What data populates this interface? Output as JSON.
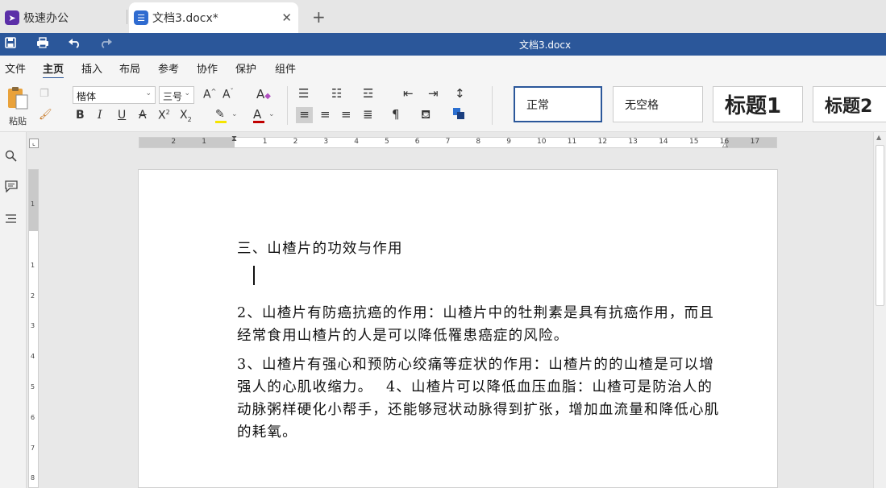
{
  "tabs": [
    {
      "label": "极速办公"
    },
    {
      "label": "文档3.docx*"
    }
  ],
  "title": "文档3.docx",
  "menu": [
    "文件",
    "主页",
    "插入",
    "布局",
    "参考",
    "协作",
    "保护",
    "组件"
  ],
  "ribbon": {
    "paste_label": "粘贴",
    "font_name": "楷体",
    "font_size": "三号",
    "styles": [
      "正常",
      "无空格",
      "标题1",
      "标题2"
    ]
  },
  "document": {
    "heading": "三、山楂片的功效与作用",
    "para1": "2、山楂片有防癌抗癌的作用：山楂片中的牡荆素是具有抗癌作用，而且经常食用山楂片的人是可以降低罹患癌症的风险。",
    "para2": "3、山楂片有强心和预防心绞痛等症状的作用：山楂片的的山楂是可以增强人的心肌收缩力。　 4、山楂片可以降低血压血脂：山楂可是防治人的动脉粥样硬化小帮手，还能够冠状动脉得到扩张，增加血流量和降低心肌的耗氧。"
  },
  "ruler": {
    "h_labels": [
      "2",
      "1",
      "1",
      "2",
      "3",
      "4",
      "5",
      "6",
      "7",
      "8",
      "9",
      "10",
      "11",
      "12",
      "13",
      "14",
      "15",
      "16",
      "17"
    ],
    "v_labels": [
      "1",
      "1",
      "2",
      "3",
      "4",
      "5",
      "6",
      "7",
      "8"
    ]
  },
  "colors": {
    "accent": "#2b579a",
    "highlight": "#f5e400",
    "font_color": "#c00000"
  }
}
